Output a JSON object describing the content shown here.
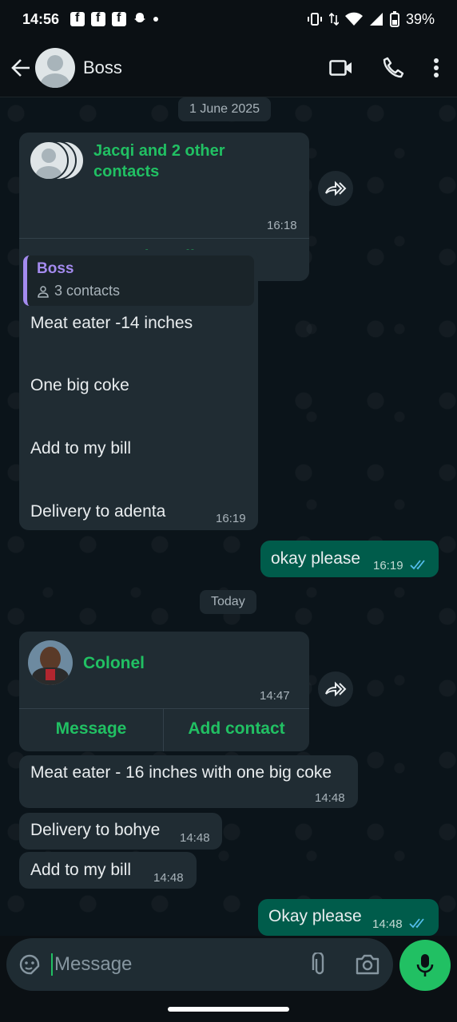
{
  "status_bar": {
    "time": "14:56",
    "battery": "39%"
  },
  "header": {
    "title": "Boss"
  },
  "dates": {
    "first": "1 June 2025",
    "second": "Today"
  },
  "contact_card_1": {
    "names": "Jacqi and 2 other contacts",
    "time": "16:18",
    "action": "View all"
  },
  "quoted_message": {
    "title": "Boss",
    "subtitle": "3 contacts",
    "lines": [
      "Meat eater -14 inches",
      "One big coke",
      "Add to my bill",
      "Delivery to adenta"
    ],
    "time": "16:19"
  },
  "outgoing_1": {
    "text": "okay please",
    "time": "16:19"
  },
  "contact_card_2": {
    "name": "Colonel",
    "time": "14:47",
    "action_message": "Message",
    "action_add": "Add contact"
  },
  "messages_in": [
    {
      "text": "Meat eater - 16 inches with one big coke",
      "time": "14:48"
    },
    {
      "text": "Delivery to bohye",
      "time": "14:48"
    },
    {
      "text": "Add to my bill",
      "time": "14:48"
    }
  ],
  "outgoing_2": {
    "text": "Okay please",
    "time": "14:48"
  },
  "composer": {
    "placeholder": "Message"
  },
  "colors": {
    "accent": "#21c063",
    "bubble_in": "#202c33",
    "bubble_out": "#005c4b",
    "tick_read": "#53bdeb"
  }
}
